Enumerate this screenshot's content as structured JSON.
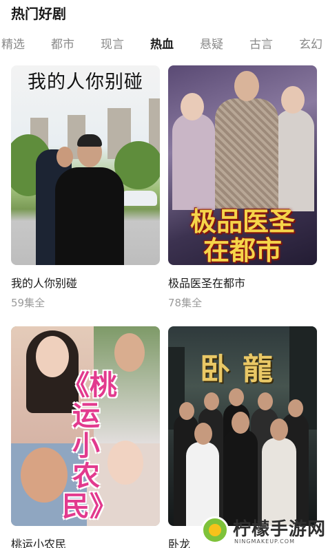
{
  "header": {
    "title": "热门好剧"
  },
  "tabs": [
    {
      "label": "精选",
      "active": false
    },
    {
      "label": "都市",
      "active": false
    },
    {
      "label": "现言",
      "active": false
    },
    {
      "label": "热血",
      "active": true
    },
    {
      "label": "悬疑",
      "active": false
    },
    {
      "label": "古言",
      "active": false
    },
    {
      "label": "玄幻",
      "active": false
    }
  ],
  "dramas": [
    {
      "title": "我的人你别碰",
      "episodes": "59集全",
      "poster_text": "我的人你别碰"
    },
    {
      "title": "极品医圣在都市",
      "episodes": "78集全",
      "poster_text_line1": "极品医圣",
      "poster_text_line2": "在都市"
    },
    {
      "title": "桃运小农民",
      "poster_text": "《桃运小农民》"
    },
    {
      "title": "卧龙",
      "poster_text": "卧龍"
    }
  ],
  "watermark": {
    "text": "柠檬手游网",
    "url": "NINGMAKEUP.COM"
  },
  "colors": {
    "active_tab": "#1a1a1a",
    "inactive_tab": "#8a8a8a",
    "meta": "#9a9a9a"
  }
}
